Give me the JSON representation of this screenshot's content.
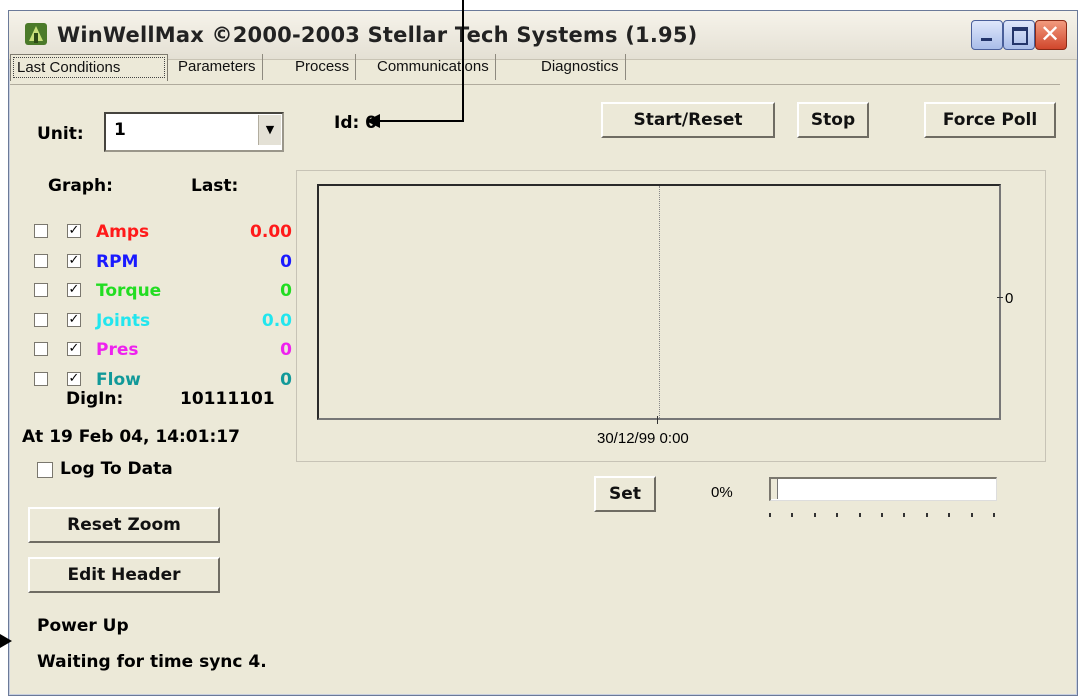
{
  "window": {
    "title": "WinWellMax   ©2000-2003 Stellar Tech Systems (1.95)",
    "icon": "wellhead-app-icon"
  },
  "tabs": [
    {
      "label": "Last Conditions",
      "active": true
    },
    {
      "label": "Parameters"
    },
    {
      "label": "Process"
    },
    {
      "label": "Communications"
    },
    {
      "label": "Diagnostics"
    }
  ],
  "unit": {
    "label": "Unit:",
    "value": "1"
  },
  "id": {
    "label": "Id:",
    "value": "0"
  },
  "buttons": {
    "start_reset": "Start/Reset",
    "stop": "Stop",
    "force_poll": "Force Poll",
    "set": "Set",
    "reset_zoom": "Reset Zoom",
    "edit_header": "Edit Header"
  },
  "graph_header": "Graph:",
  "last_header": "Last:",
  "channels": [
    {
      "name": "Amps",
      "value": "0.00",
      "color": "#ff1a1a",
      "graph": false,
      "enabled": true
    },
    {
      "name": "RPM",
      "value": "0",
      "color": "#1a1aff",
      "graph": false,
      "enabled": true
    },
    {
      "name": "Torque",
      "value": "0",
      "color": "#22dd22",
      "graph": false,
      "enabled": true
    },
    {
      "name": "Joints",
      "value": "0.0",
      "color": "#22e6ee",
      "graph": false,
      "enabled": true
    },
    {
      "name": "Pres",
      "value": "0",
      "color": "#ee22ee",
      "graph": false,
      "enabled": true
    },
    {
      "name": "Flow",
      "value": "0",
      "color": "#119999",
      "graph": false,
      "enabled": true
    }
  ],
  "digin": {
    "label": "DigIn:",
    "value": "10111101"
  },
  "timestamp": "At 19 Feb 04, 14:01:17",
  "log_to_data": {
    "label": "Log To Data",
    "checked": false
  },
  "plot": {
    "x_label": "30/12/99 0:00",
    "y_label": "0"
  },
  "slider": {
    "percent_label": "0%",
    "value_percent": 0
  },
  "status": {
    "line1": "Power Up",
    "line2": "Waiting for time sync 4."
  }
}
